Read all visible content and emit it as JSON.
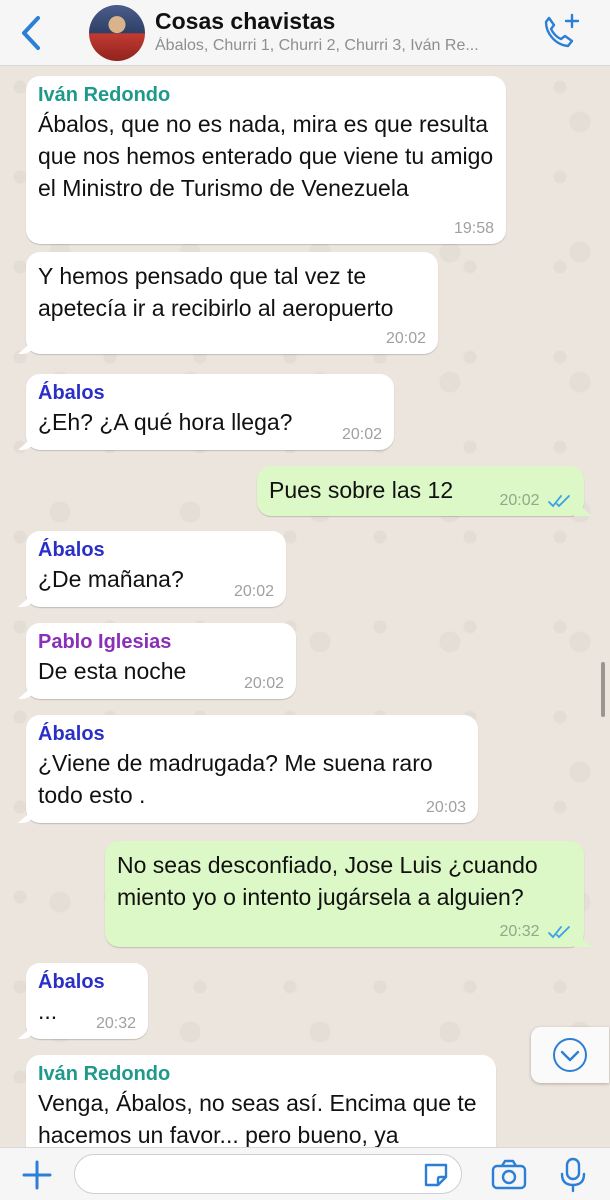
{
  "header": {
    "title": "Cosas chavistas",
    "subtitle": "Ábalos, Churri 1, Churri 2, Churri 3, Iván Re...",
    "icons": {
      "back": "chevron-left-icon",
      "avatar": "group-avatar",
      "call": "add-call-icon"
    }
  },
  "colors": {
    "accent": "#2c7fd6",
    "incoming": "#ffffff",
    "outgoing": "#dcf8c6",
    "ivan": "#1f9a8a",
    "abalos": "#2a30c7",
    "pablo": "#8a2fb8"
  },
  "messages": [
    {
      "sender": "Iván Redondo",
      "text": "Ábalos, que no es nada, mira es que resulta que nos hemos enterado que viene tu amigo el Ministro de Turismo de Venezuela",
      "time": "19:58"
    },
    {
      "sender": "",
      "text": "Y hemos pensado que tal vez te apetecía ir a recibirlo al aeropuerto",
      "time": "20:02"
    },
    {
      "sender": "Ábalos",
      "text": "¿Eh? ¿A qué hora llega?",
      "time": "20:02"
    },
    {
      "sender": "",
      "text": "Pues sobre las 12",
      "time": "20:02"
    },
    {
      "sender": "Ábalos",
      "text": "¿De mañana?",
      "time": "20:02"
    },
    {
      "sender": "Pablo Iglesias",
      "text": "De esta noche",
      "time": "20:02"
    },
    {
      "sender": "Ábalos",
      "text": "¿Viene de madrugada? Me suena raro todo esto .",
      "time": "20:03"
    },
    {
      "sender": "",
      "text": "No seas desconfiado, Jose Luis ¿cuando miento yo o intento jugársela a alguien?",
      "time": "20:32"
    },
    {
      "sender": "Ábalos",
      "text": "...",
      "time": "20:32"
    },
    {
      "sender": "Iván Redondo",
      "text": "Venga, Ábalos, no seas así. Encima que te hacemos un favor... pero bueno, ya",
      "time": ""
    }
  ],
  "footer": {
    "input_value": "",
    "icons": {
      "add": "plus-icon",
      "sticker": "sticker-icon",
      "camera": "camera-icon",
      "mic": "microphone-icon"
    }
  }
}
